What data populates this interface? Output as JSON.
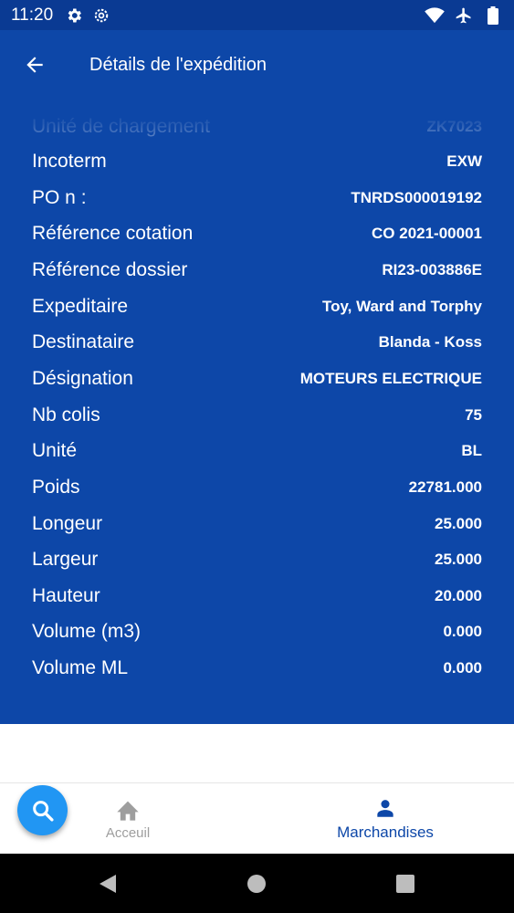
{
  "status_bar": {
    "time": "11:20",
    "left_icons": [
      "settings-gear-icon",
      "settings-cog-icon"
    ],
    "right_icons": [
      "wifi-icon",
      "airplane-icon",
      "battery-icon"
    ]
  },
  "app_bar": {
    "title": "Détails de l'expédition",
    "back_icon": "arrow-back-icon"
  },
  "details": {
    "partial_top": {
      "label": "Unité de chargement",
      "value": "ZK7023"
    },
    "rows": [
      {
        "label": "Incoterm",
        "value": "EXW"
      },
      {
        "label": "PO n :",
        "value": "TNRDS000019192"
      },
      {
        "label": "Référence cotation",
        "value": "CO 2021-00001"
      },
      {
        "label": "Référence dossier",
        "value": "RI23-003886E"
      },
      {
        "label": "Expeditaire",
        "value": "Toy, Ward and Torphy"
      },
      {
        "label": "Destinataire",
        "value": "Blanda - Koss"
      },
      {
        "label": "Désignation",
        "value": "MOTEURS ELECTRIQUE"
      },
      {
        "label": "Nb colis",
        "value": "75"
      },
      {
        "label": "Unité",
        "value": "BL"
      },
      {
        "label": "Poids",
        "value": "22781.000"
      },
      {
        "label": "Longeur",
        "value": "25.000"
      },
      {
        "label": "Largeur",
        "value": "25.000"
      },
      {
        "label": "Hauteur",
        "value": "20.000"
      },
      {
        "label": "Volume (m3)",
        "value": "0.000"
      },
      {
        "label": "Volume ML",
        "value": "0.000"
      }
    ]
  },
  "bottom_nav": {
    "home_label": "Acceuil",
    "goods_label": "Marchandises",
    "home_icon": "home-icon",
    "goods_icon": "person-icon",
    "active": "Marchandises"
  },
  "fab": {
    "icon": "search-icon"
  },
  "system_nav": {
    "icons": [
      "back-triangle-icon",
      "home-circle-icon",
      "recents-square-icon"
    ]
  },
  "colors": {
    "primary": "#0d47a8",
    "status_bar": "#0a3a93",
    "fab": "#2196f3",
    "inactive_nav": "#9e9e9e"
  }
}
